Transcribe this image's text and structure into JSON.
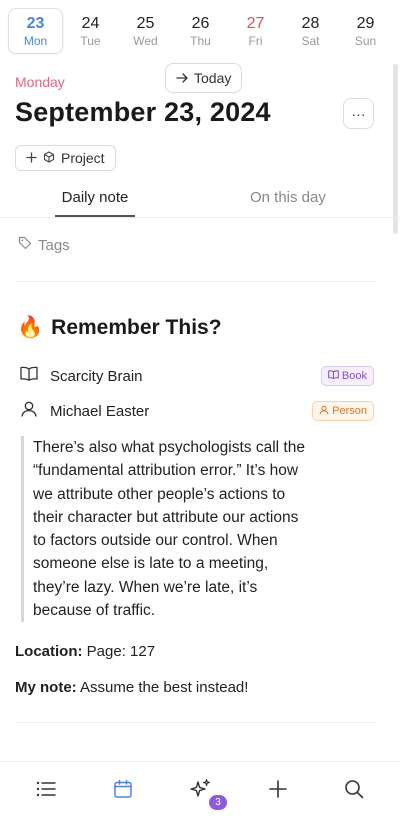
{
  "week": [
    {
      "num": "23",
      "wd": "Mon"
    },
    {
      "num": "24",
      "wd": "Tue"
    },
    {
      "num": "25",
      "wd": "Wed"
    },
    {
      "num": "26",
      "wd": "Thu"
    },
    {
      "num": "27",
      "wd": "Fri"
    },
    {
      "num": "28",
      "wd": "Sat"
    },
    {
      "num": "29",
      "wd": "Sun"
    }
  ],
  "header": {
    "weekday": "Monday",
    "today_label": "Today",
    "title": "September 23, 2024",
    "more_label": "···",
    "project_label": "Project"
  },
  "tabs": {
    "daily": "Daily note",
    "on_this_day": "On this day"
  },
  "tags_label": "Tags",
  "remember": {
    "emoji": "🔥",
    "title": "Remember This?",
    "source": "Scarcity Brain",
    "source_badge": "Book",
    "author": "Michael Easter",
    "author_badge": "Person",
    "quote_lines": [
      "There’s also what psychologists call the",
      "“fundamental attribution error.” It’s how",
      "we attribute other people’s actions to",
      "their character but attribute our actions",
      "to factors outside our control. When",
      "someone else is late to a meeting,",
      "they’re lazy. When we’re late, it’s",
      "because of traffic."
    ],
    "location_label": "Location:",
    "location_value": "Page: 127",
    "note_label": "My note:",
    "note_value": "Assume the best instead!"
  },
  "nav": {
    "ai_badge": "3"
  },
  "colors": {
    "accent": "#4a86d8",
    "weekday_pink": "#e0677d",
    "holiday_red": "#d9534f",
    "book_purple": "#8a4fcf",
    "person_orange": "#d9772e",
    "ai_badge_purple": "#8a5bdf"
  }
}
